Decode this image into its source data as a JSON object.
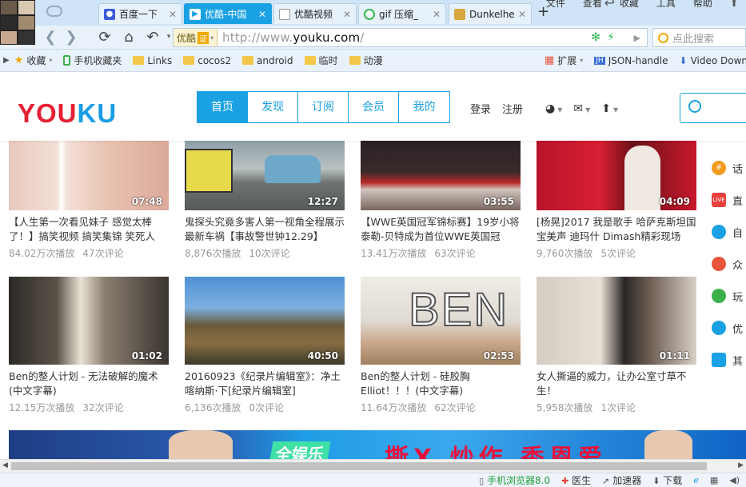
{
  "browser": {
    "tabs": [
      {
        "label": "百度一下",
        "favicon_color": "#3b5bdb",
        "favicon_glyph": "🐾",
        "active": false
      },
      {
        "label": "优酷-中国",
        "favicon_color": "#1aa1e3",
        "favicon_glyph": "▶",
        "active": true
      },
      {
        "label": "优酷视频",
        "favicon_color": "#ffffff",
        "favicon_glyph": "",
        "active": false
      },
      {
        "label": "gif 压缩_",
        "favicon_color": "#2db84d",
        "favicon_glyph": "◯",
        "active": false
      },
      {
        "label": "Dunkelhe",
        "favicon_color": "#d8a840",
        "favicon_glyph": "▦",
        "active": false
      }
    ],
    "new_tab_label": "+",
    "menu": [
      "文件",
      "查看",
      "收藏",
      "工具",
      "帮助"
    ],
    "address": {
      "badge": "优酷",
      "cert": "证",
      "url_prefix": "http://www.",
      "url_host": "youku.com",
      "url_suffix": "/"
    },
    "search_placeholder": "点此搜索",
    "bookmarks": [
      {
        "label": "收藏",
        "type": "star"
      },
      {
        "label": "手机收藏夹",
        "type": "phone"
      },
      {
        "label": "Links",
        "type": "folder"
      },
      {
        "label": "cocos2",
        "type": "folder"
      },
      {
        "label": "android",
        "type": "folder"
      },
      {
        "label": "临时",
        "type": "folder"
      },
      {
        "label": "动漫",
        "type": "folder"
      }
    ],
    "bookmarks_right": [
      "扩展",
      "JSON-handle",
      "Video Down"
    ]
  },
  "youku": {
    "logo_red": "YOU",
    "logo_blue": "KU",
    "nav": [
      "首页",
      "发现",
      "订阅",
      "会员",
      "我的"
    ],
    "nav_active": 0,
    "login": "登录",
    "register": "注册",
    "accent": "#1aa1e3",
    "videos": [
      {
        "title": "【人生第一次看见妹子 感觉太棒了！】搞笑视频 搞笑集锦 笑死人",
        "duration": "07:48",
        "plays": "84.02万次播放",
        "comments": "47次评论"
      },
      {
        "title": "鬼探头究竟多害人第一视角全程展示最新车祸【事故警世钟12.29】",
        "duration": "12:27",
        "plays": "8,876次播放",
        "comments": "10次评论"
      },
      {
        "title": "【WWE英国冠军锦标赛】19岁小将泰勒-贝特成为首位WWE英国冠",
        "duration": "03:55",
        "plays": "13.41万次播放",
        "comments": "63次评论"
      },
      {
        "title": "[杨晃]2017 我是歌手 哈萨克斯坦国宝美声 迪玛什 Dimash精彩现场",
        "duration": "04:09",
        "plays": "9,760次播放",
        "comments": "5次评论"
      },
      {
        "title": "Ben的整人计划 - 无法破解的魔术(中文字幕)",
        "duration": "01:02",
        "plays": "12.15万次播放",
        "comments": "32次评论"
      },
      {
        "title": "20160923《纪录片编辑室》：净土喀纳斯·下[纪录片编辑室]",
        "duration": "40:50",
        "plays": "6,136次播放",
        "comments": "0次评论"
      },
      {
        "title": "Ben的整人计划 - 硅胶胸Elliot！！！(中文字幕)",
        "duration": "02:53",
        "plays": "11.64万次播放",
        "comments": "62次评论"
      },
      {
        "title": "女人撕逼的威力，让办公室寸草不生！",
        "duration": "01:11",
        "plays": "5,958次播放",
        "comments": "1次评论"
      }
    ],
    "side_menu": [
      {
        "label": "话",
        "color": "#f39c1f",
        "glyph": "#"
      },
      {
        "label": "直",
        "color": "#e8413b",
        "glyph": "LIVE"
      },
      {
        "label": "自",
        "color": "#1aa1e3",
        "glyph": "●"
      },
      {
        "label": "众",
        "color": "#e8553b",
        "glyph": "●"
      },
      {
        "label": "玩",
        "color": "#3cb04a",
        "glyph": "●"
      },
      {
        "label": "优",
        "color": "#1aa1e3",
        "glyph": "●"
      },
      {
        "label": "其",
        "color": "#1aa1e3",
        "glyph": "●"
      }
    ],
    "banner_tag": "全娱乐",
    "banner_text": "撕X 炒作 秀恩爱"
  },
  "status": {
    "items": [
      "手机浏览器8.0",
      "医生",
      "加速器",
      "下载"
    ]
  }
}
